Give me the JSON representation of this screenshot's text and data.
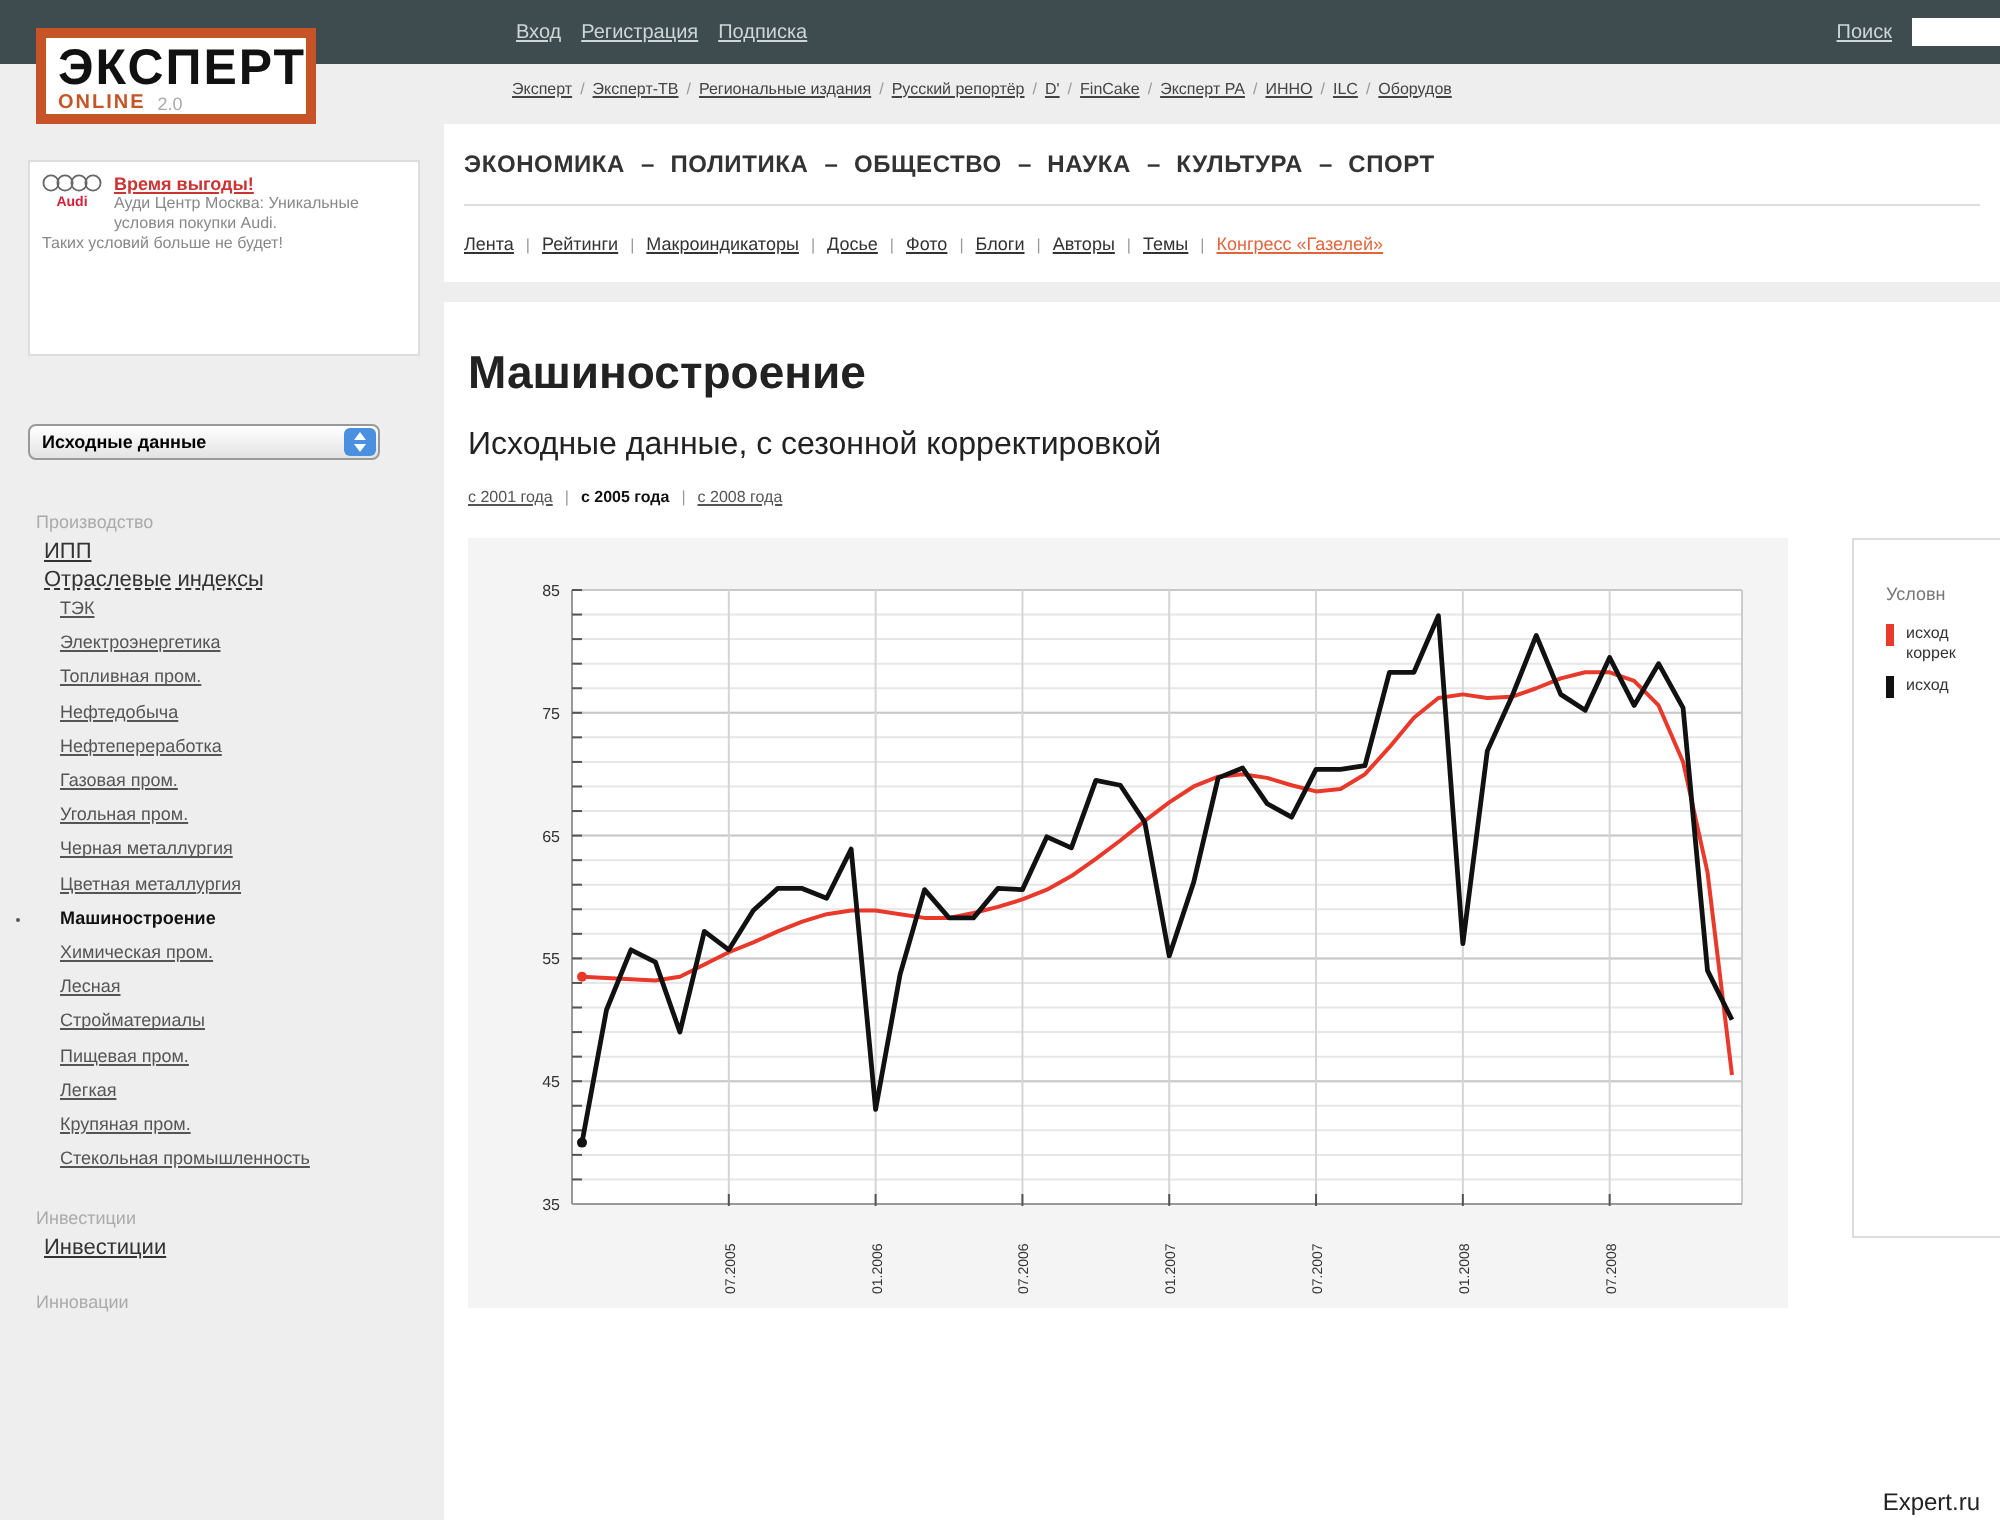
{
  "top_bar": {
    "links": [
      "Вход",
      "Регистрация",
      "Подписка"
    ],
    "search_label": "Поиск"
  },
  "logo": {
    "title": "ЭКСПЕРТ",
    "subtitle": "ONLINE",
    "version": "2.0"
  },
  "network_separator": "/",
  "sections_separator": "–",
  "sub_nav_separator": "|",
  "network_links": [
    "Эксперт",
    "Эксперт-ТВ",
    "Региональные издания",
    "Русский репортёр",
    "D'",
    "FinCake",
    "Эксперт РА",
    "ИННО",
    "ILC",
    "Оборудов"
  ],
  "ad": {
    "brand": "Audi",
    "headline": "Время выгоды!",
    "body": "Ауди Центр Москва: Уникальные условия покупки Audi.",
    "footer": "Таких условий больше не будет!"
  },
  "sections_nav": [
    "ЭКОНОМИКА",
    "ПОЛИТИКА",
    "ОБЩЕСТВО",
    "НАУКА",
    "КУЛЬТУРА",
    "СПОРТ"
  ],
  "sub_nav": [
    {
      "label": "Лента",
      "kind": "link"
    },
    {
      "label": "Рейтинги",
      "kind": "link"
    },
    {
      "label": "Макроиндикаторы",
      "kind": "link"
    },
    {
      "label": "Досье",
      "kind": "link"
    },
    {
      "label": "Фото",
      "kind": "link"
    },
    {
      "label": "Блоги",
      "kind": "link"
    },
    {
      "label": "Авторы",
      "kind": "link"
    },
    {
      "label": "Темы",
      "kind": "link"
    },
    {
      "label": "Конгресс «Газелей»",
      "kind": "promo"
    }
  ],
  "sidebar": {
    "select": {
      "value": "Исходные данные"
    },
    "sections": [
      {
        "heading": "Производство",
        "items": [
          {
            "label": "ИПП",
            "selected": false
          },
          {
            "label": "Отраслевые индексы",
            "selected": false,
            "children": [
              {
                "label": "ТЭК",
                "selected": false
              },
              {
                "label": "Электроэнергетика",
                "selected": false
              },
              {
                "label": "Топливная пром.",
                "selected": false
              },
              {
                "label": "Нефтедобыча",
                "selected": false
              },
              {
                "label": "Нефтепереработка",
                "selected": false
              },
              {
                "label": "Газовая пром.",
                "selected": false
              },
              {
                "label": "Угольная пром.",
                "selected": false
              },
              {
                "label": "Черная металлургия",
                "selected": false
              },
              {
                "label": "Цветная металлургия",
                "selected": false
              },
              {
                "label": "Машиностроение",
                "selected": true
              },
              {
                "label": "Химическая пром.",
                "selected": false
              },
              {
                "label": "Лесная",
                "selected": false
              },
              {
                "label": "Стройматериалы",
                "selected": false
              },
              {
                "label": "Пищевая пром.",
                "selected": false
              },
              {
                "label": "Легкая",
                "selected": false
              },
              {
                "label": "Крупяная пром.",
                "selected": false
              },
              {
                "label": "Стекольная промышленность",
                "selected": false
              }
            ]
          }
        ]
      },
      {
        "heading": "Инвестиции",
        "items": [
          {
            "label": "Инвестиции",
            "selected": false
          }
        ]
      },
      {
        "heading": "Инновации"
      }
    ]
  },
  "content": {
    "title": "Машиностроение",
    "subtitle": "Исходные данные, с сезонной корректировкой",
    "period_separator": "|",
    "periods": [
      {
        "label": "с 2001 года",
        "selected": false
      },
      {
        "label": "с 2005 года",
        "selected": true
      },
      {
        "label": "с 2008 года",
        "selected": false
      }
    ],
    "chart_data": {
      "type": "line",
      "grid": true,
      "ylim": [
        35,
        85
      ],
      "yticks": [
        35,
        45,
        55,
        65,
        75,
        85
      ],
      "categories": [
        null,
        null,
        null,
        null,
        null,
        null,
        "07.2005",
        null,
        null,
        null,
        null,
        null,
        "01.2006",
        null,
        null,
        null,
        null,
        null,
        "07.2006",
        null,
        null,
        null,
        null,
        null,
        "01.2007",
        null,
        null,
        null,
        null,
        null,
        "07.2007",
        null,
        null,
        null,
        null,
        null,
        "01.2008",
        null,
        null,
        null,
        null,
        null,
        "07.2008",
        null,
        null,
        null,
        null,
        null
      ],
      "series": [
        {
          "name": "исход коррек",
          "color": "#e8392b",
          "values": [
            53.5,
            53.4,
            53.3,
            53.2,
            53.5,
            54.5,
            55.5,
            56.3,
            57.2,
            58,
            58.6,
            58.9,
            58.9,
            58.6,
            58.3,
            58.3,
            58.7,
            59.2,
            59.8,
            60.6,
            61.7,
            63.1,
            64.6,
            66.2,
            67.7,
            69,
            69.8,
            70,
            69.7,
            69.1,
            68.6,
            68.8,
            70,
            72.2,
            74.6,
            76.2,
            76.5,
            76.2,
            76.3,
            77,
            77.8,
            78.3,
            78.3,
            77.6,
            75.6,
            71,
            62,
            45.5
          ]
        },
        {
          "name": "исход",
          "color": "#111111",
          "values": [
            40,
            50.8,
            55.7,
            54.7,
            49,
            57.2,
            55.7,
            58.9,
            60.7,
            60.7,
            59.9,
            63.9,
            42.7,
            53.7,
            60.6,
            58.3,
            58.3,
            60.7,
            60.6,
            64.9,
            64,
            69.5,
            69.1,
            66.1,
            55.2,
            61.2,
            69.7,
            70.5,
            67.6,
            66.5,
            70.4,
            70.4,
            70.7,
            78.3,
            78.3,
            82.9,
            56.2,
            71.9,
            76.3,
            81.3,
            76.5,
            75.2,
            79.5,
            75.6,
            79,
            75.4,
            54,
            50
          ]
        }
      ]
    },
    "legend": {
      "title": "Условн"
    }
  },
  "source_caption": "Expert.ru"
}
